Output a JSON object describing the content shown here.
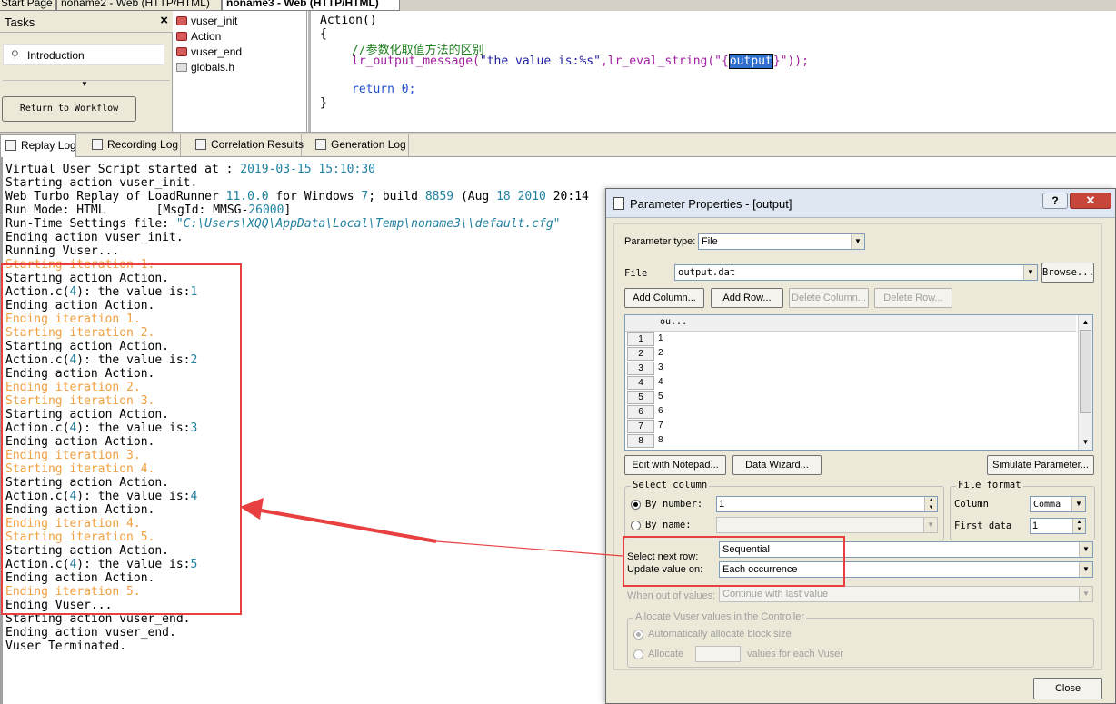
{
  "doc_tabs": [
    {
      "label": "Start Page",
      "active": false
    },
    {
      "label": "noname2 - Web (HTTP/HTML)",
      "active": false
    },
    {
      "label": "noname3 - Web (HTTP/HTML)",
      "active": true
    }
  ],
  "tasks": {
    "title": "Tasks",
    "close_icon": "×",
    "introduction": "Introduction",
    "return_button": "Return to Workflow"
  },
  "action_tree": {
    "items": [
      {
        "label": "vuser_init",
        "icon": "action-icon"
      },
      {
        "label": "Action",
        "icon": "action-icon"
      },
      {
        "label": "vuser_end",
        "icon": "action-icon"
      },
      {
        "label": "globals.h",
        "icon": "header-file-icon"
      }
    ]
  },
  "code": {
    "line1": "Action()",
    "line2": "{",
    "comment": "//参数化取值方法的区别",
    "call_func": "lr_output_message(",
    "call_str1": "\"the value is:%s\"",
    "call_mid": ",lr_eval_string(\"{",
    "call_sel": "output",
    "call_end": "}\"));",
    "return_kw": "return",
    "return_val": " 0;",
    "line_close": "}"
  },
  "log_tabs": [
    {
      "label": "Replay Log",
      "active": true,
      "icon": "replay-log-icon"
    },
    {
      "label": "Recording Log",
      "active": false,
      "icon": "recording-log-icon"
    },
    {
      "label": "Correlation Results",
      "active": false,
      "icon": "correlation-icon"
    },
    {
      "label": "Generation Log",
      "active": false,
      "icon": "generation-log-icon"
    }
  ],
  "replay_log": {
    "started_prefix": "Virtual User Script started at : ",
    "started_time": "2019-03-15 15:10:30",
    "lines_plain": {
      "starting_init": "Starting action vuser_init.",
      "run_mode_prefix": "Run Mode: HTML",
      "msgid_prefix": "[MsgId: MMSG-",
      "msgid_num": "26000",
      "msgid_suffix": "]",
      "rts_prefix": "Run-Time Settings file: ",
      "rts_path": "\"C:\\Users\\XQQ\\AppData\\Local\\Temp\\noname3\\\\default.cfg\"",
      "ending_init": "Ending action vuser_init.",
      "running": "Running Vuser...",
      "ending_vuser": "Ending Vuser...",
      "starting_end": "Starting action vuser_end.",
      "ending_end": "Ending action vuser_end.",
      "terminated": "Vuser Terminated."
    },
    "web_turbo": {
      "prefix": "Web Turbo Replay of LoadRunner ",
      "version": "11.0.0",
      "mid": " for Windows ",
      "win": "7",
      "build_prefix": "; build ",
      "build": "8859",
      "date_prefix": " (Aug ",
      "day": "18",
      "sp": " ",
      "year": "2010",
      "time": "20:14"
    },
    "iterations": [
      {
        "start": "Starting iteration 1.",
        "sa": "Starting action Action.",
        "msg_prefix": "Action.c(",
        "line": "4",
        "msg_mid": "): the value is:",
        "value": "1",
        "ea": "Ending action Action.",
        "end": "Ending iteration 1."
      },
      {
        "start": "Starting iteration 2.",
        "sa": "Starting action Action.",
        "msg_prefix": "Action.c(",
        "line": "4",
        "msg_mid": "): the value is:",
        "value": "2",
        "ea": "Ending action Action.",
        "end": "Ending iteration 2."
      },
      {
        "start": "Starting iteration 3.",
        "sa": "Starting action Action.",
        "msg_prefix": "Action.c(",
        "line": "4",
        "msg_mid": "): the value is:",
        "value": "3",
        "ea": "Ending action Action.",
        "end": "Ending iteration 3."
      },
      {
        "start": "Starting iteration 4.",
        "sa": "Starting action Action.",
        "msg_prefix": "Action.c(",
        "line": "4",
        "msg_mid": "): the value is:",
        "value": "4",
        "ea": "Ending action Action.",
        "end": "Ending iteration 4."
      },
      {
        "start": "Starting iteration 5.",
        "sa": "Starting action Action.",
        "msg_prefix": "Action.c(",
        "line": "4",
        "msg_mid": "): the value is:",
        "value": "5",
        "ea": "Ending action Action.",
        "end": "Ending iteration 5."
      }
    ]
  },
  "dialog": {
    "title": "Parameter Properties - [output]",
    "help": "?",
    "close_x": "✕",
    "parameter_type_label": "Parameter type:",
    "parameter_type_value": "File",
    "file_label": "File",
    "file_value": "output.dat",
    "browse": "Browse...",
    "add_column": "Add Column...",
    "add_row": "Add Row...",
    "delete_column": "Delete Column...",
    "delete_row": "Delete Row...",
    "grid": {
      "column_header": "ou...",
      "rows": [
        {
          "n": "1",
          "v": "1"
        },
        {
          "n": "2",
          "v": "2"
        },
        {
          "n": "3",
          "v": "3"
        },
        {
          "n": "4",
          "v": "4"
        },
        {
          "n": "5",
          "v": "5"
        },
        {
          "n": "6",
          "v": "6"
        },
        {
          "n": "7",
          "v": "7"
        },
        {
          "n": "8",
          "v": "8"
        }
      ]
    },
    "edit_notepad": "Edit with Notepad...",
    "data_wizard": "Data Wizard...",
    "simulate": "Simulate Parameter...",
    "select_column": {
      "title": "Select column",
      "by_number_label": "By number:",
      "by_number_value": "1",
      "by_name_label": "By name:"
    },
    "file_format": {
      "title": "File format",
      "column_label": "Column",
      "column_value": "Comma",
      "first_data_label": "First data",
      "first_data_value": "1"
    },
    "select_next_row_label": "Select next row:",
    "select_next_row_value": "Sequential",
    "update_value_label": "Update value on:",
    "update_value_value": "Each occurrence",
    "out_of_values_label": "When out of values:",
    "out_of_values_value": "Continue with last value",
    "allocate_group": {
      "title": "Allocate Vuser values in the Controller",
      "auto_label": "Automatically allocate block size",
      "allocate_label": "Allocate",
      "values_label": "values for each Vuser"
    },
    "close_button": "Close"
  },
  "colors": {
    "annotation_red": "#e84040",
    "iteration_orange": "#f0a040",
    "number_teal": "#2080a0"
  }
}
